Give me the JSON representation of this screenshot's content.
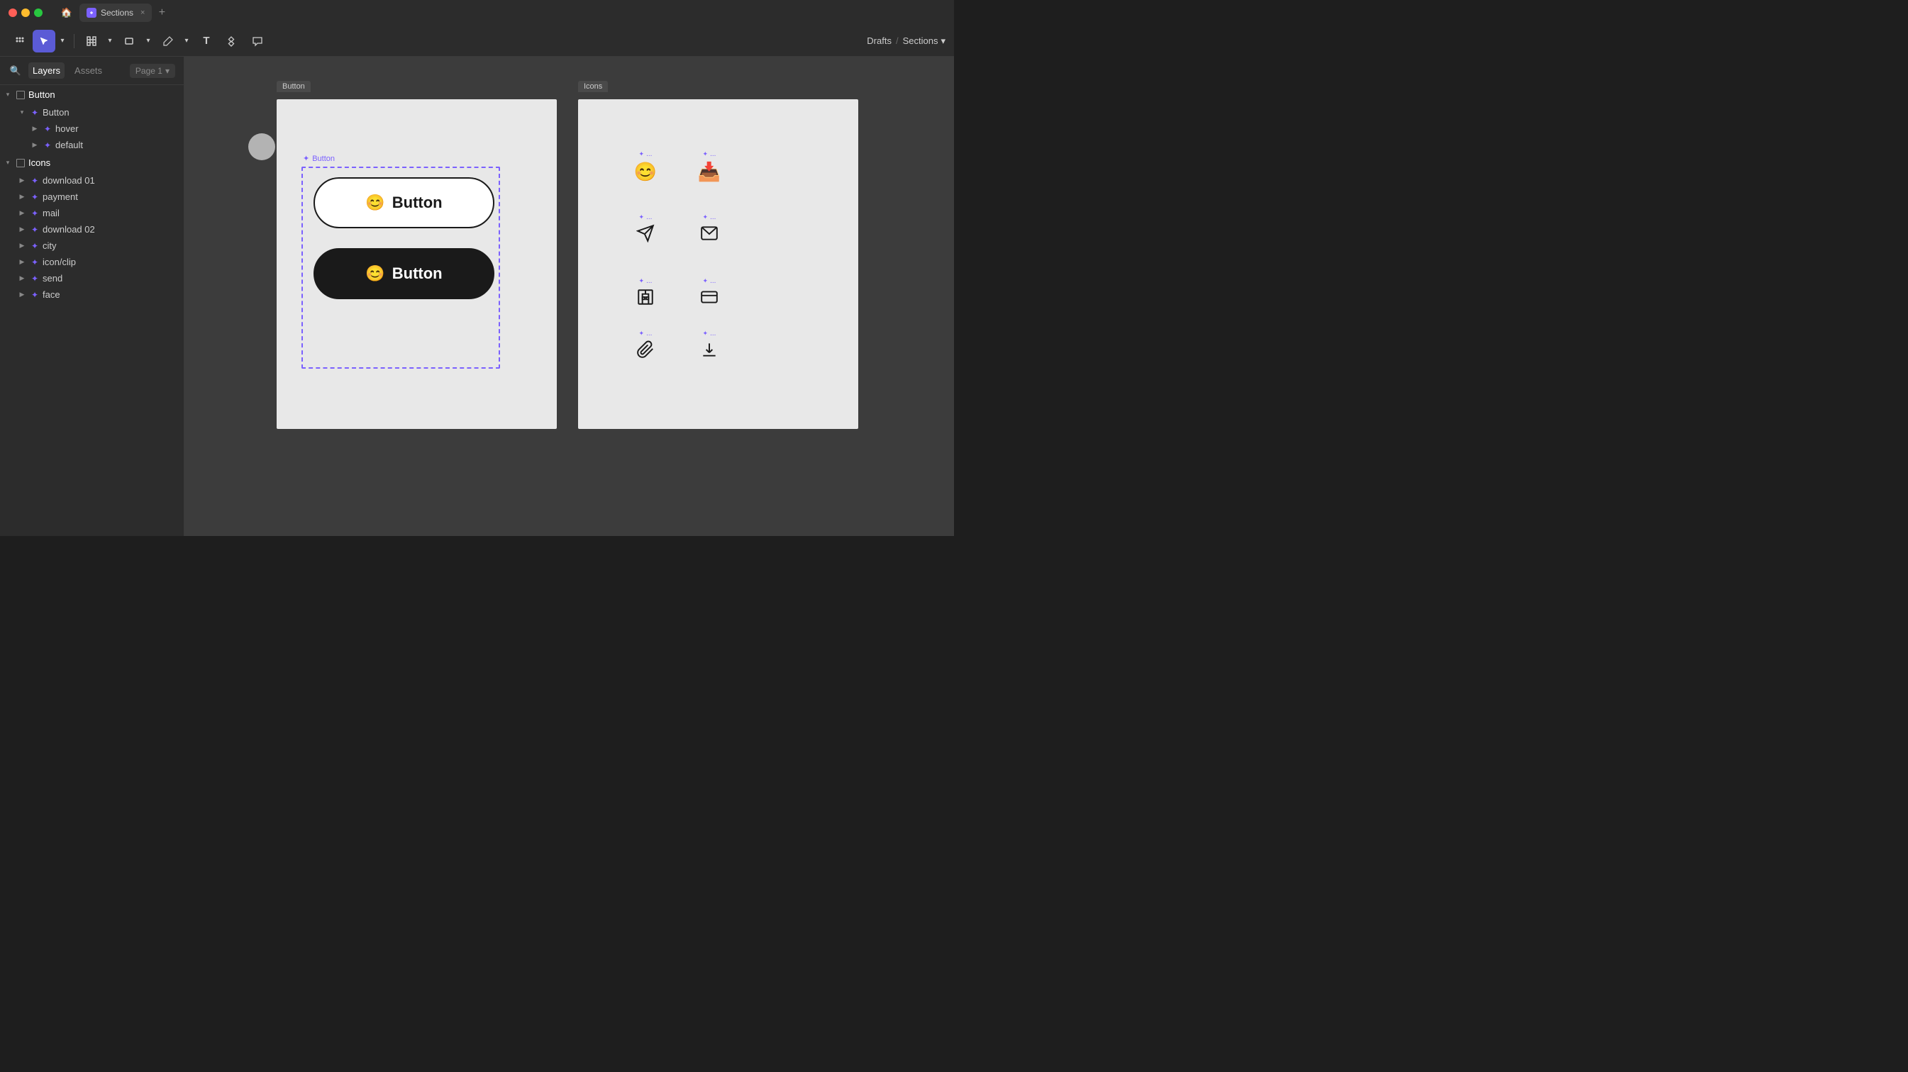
{
  "window": {
    "title": "Sections",
    "tab_label": "Sections"
  },
  "titlebar": {
    "home_icon": "🏠",
    "tab_favicon": "F",
    "tab_name": "Sections",
    "tab_close": "×",
    "add_tab": "+"
  },
  "toolbar": {
    "tools": [
      {
        "id": "move",
        "label": "⊹",
        "active": false
      },
      {
        "id": "select",
        "label": "↖",
        "active": true
      },
      {
        "id": "frame",
        "label": "⊡",
        "active": false
      },
      {
        "id": "shape",
        "label": "□",
        "active": false
      },
      {
        "id": "pen",
        "label": "✒",
        "active": false
      },
      {
        "id": "text",
        "label": "T",
        "active": false
      },
      {
        "id": "component",
        "label": "⊛",
        "active": false
      },
      {
        "id": "comment",
        "label": "💬",
        "active": false
      }
    ],
    "breadcrumb_drafts": "Drafts",
    "breadcrumb_sep": "/",
    "breadcrumb_current": "Sections",
    "breadcrumb_chevron": "▾"
  },
  "left_panel": {
    "search_icon": "🔍",
    "tabs": [
      {
        "id": "layers",
        "label": "Layers",
        "active": true
      },
      {
        "id": "assets",
        "label": "Assets",
        "active": false
      }
    ],
    "page_selector": "Page 1",
    "page_chevron": "▾",
    "layers": [
      {
        "id": "button-section",
        "type": "section",
        "label": "Button",
        "expanded": true,
        "indent": 0,
        "children": [
          {
            "id": "button-frame",
            "type": "frame",
            "label": "Button",
            "expanded": true,
            "indent": 1,
            "children": [
              {
                "id": "hover",
                "type": "component",
                "label": "hover",
                "indent": 2
              },
              {
                "id": "default",
                "type": "component",
                "label": "default",
                "indent": 2
              }
            ]
          }
        ]
      },
      {
        "id": "icons-section",
        "type": "section",
        "label": "Icons",
        "expanded": true,
        "indent": 0,
        "children": [
          {
            "id": "download01",
            "type": "component",
            "label": "download 01",
            "indent": 1
          },
          {
            "id": "payment",
            "type": "component",
            "label": "payment",
            "indent": 1
          },
          {
            "id": "mail",
            "type": "component",
            "label": "mail",
            "indent": 1
          },
          {
            "id": "download02",
            "type": "component",
            "label": "download 02",
            "indent": 1
          },
          {
            "id": "city",
            "type": "component",
            "label": "city",
            "indent": 1
          },
          {
            "id": "iconclip",
            "type": "component",
            "label": "icon/clip",
            "indent": 1
          },
          {
            "id": "send",
            "type": "component",
            "label": "send",
            "indent": 1
          },
          {
            "id": "face",
            "type": "component",
            "label": "face",
            "indent": 1
          }
        ]
      }
    ]
  },
  "canvas": {
    "button_section_label": "Button",
    "icons_section_label": "Icons",
    "button_label": "Button",
    "component_tag": "Button",
    "buttons": [
      {
        "style": "white",
        "text": "Button"
      },
      {
        "style": "black",
        "text": "Button"
      }
    ],
    "icons": [
      {
        "emoji": "😊",
        "label": "..."
      },
      {
        "emoji": "📥",
        "label": "..."
      },
      {
        "emoji": "✈",
        "label": "..."
      },
      {
        "emoji": "✉",
        "label": "..."
      },
      {
        "emoji": "🏢",
        "label": "..."
      },
      {
        "emoji": "💳",
        "label": "..."
      },
      {
        "emoji": "📎",
        "label": "..."
      },
      {
        "emoji": "↓",
        "label": "..."
      }
    ]
  }
}
